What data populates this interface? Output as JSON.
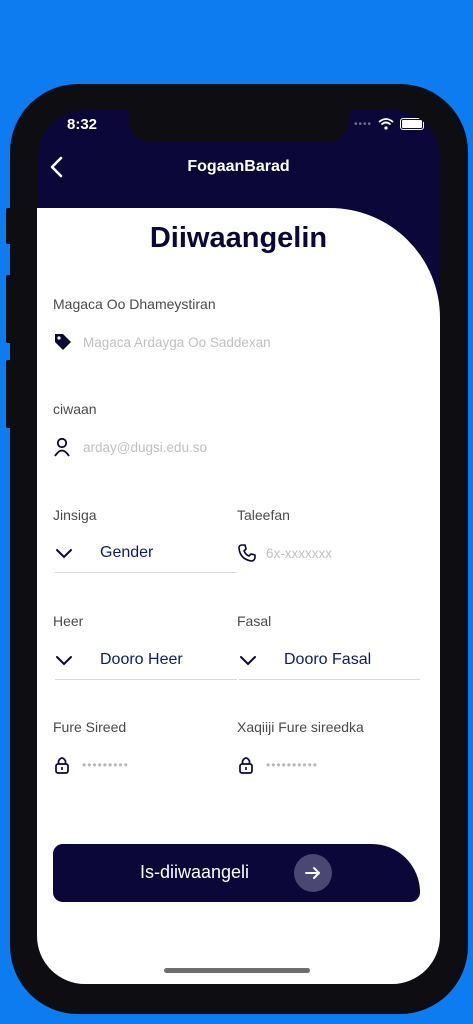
{
  "status_bar": {
    "time": "8:32"
  },
  "nav": {
    "title": "FogaanBarad"
  },
  "form": {
    "heading": "Diiwaangelin",
    "full_name": {
      "label": "Magaca Oo Dhameystiran",
      "placeholder": "Magaca Ardayga Oo Saddexan"
    },
    "email": {
      "label": "ciwaan",
      "placeholder": "arday@dugsi.edu.so"
    },
    "gender": {
      "label": "Jinsiga",
      "value": "Gender"
    },
    "phone": {
      "label": "Taleefan",
      "placeholder": "6x-xxxxxxx"
    },
    "level": {
      "label": "Heer",
      "value": "Dooro Heer"
    },
    "class": {
      "label": "Fasal",
      "value": "Dooro Fasal"
    },
    "password": {
      "label": "Fure Sireed",
      "placeholder": "•••••••••"
    },
    "confirm_password": {
      "label": "Xaqiiji Fure sireedka",
      "placeholder": "••••••••••"
    }
  },
  "submit": {
    "label": "Is-diiwaangeli"
  },
  "icons": {
    "back": "chevron-left-icon",
    "name": "tag-icon",
    "email": "person-icon",
    "phone": "phone-icon",
    "dropdown": "chevron-down-icon",
    "password": "lock-icon",
    "submit": "arrow-right-icon"
  },
  "colors": {
    "page_background": "#0c7cf0",
    "header_background": "#0b0738",
    "accent_text": "#0b1a6e",
    "card_background": "#ffffff"
  }
}
